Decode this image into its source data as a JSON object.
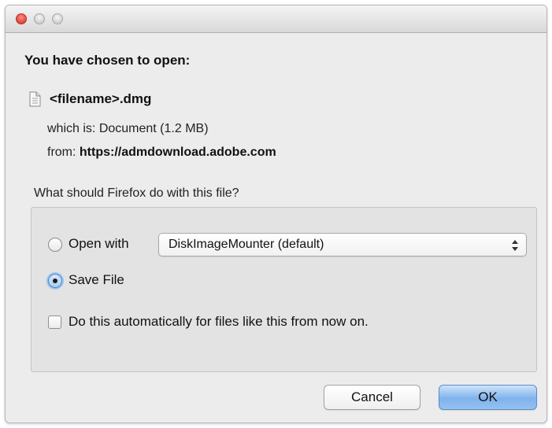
{
  "window": {
    "heading": "You have chosen to open:"
  },
  "file": {
    "name": "<filename>.dmg",
    "icon": "document-icon",
    "which_is_label": "which is:",
    "which_is_value": "Document (1.2 MB)",
    "from_label": "from:",
    "from_value": "https://admdownload.adobe.com"
  },
  "question": "What should Firefox do with this file?",
  "options": {
    "open_with": {
      "label": "Open with",
      "selected": false,
      "app_value": "DiskImageMounter (default)"
    },
    "save_file": {
      "label": "Save File",
      "selected": true
    },
    "auto": {
      "label": "Do this automatically for files like this from now on.",
      "checked": false
    }
  },
  "buttons": {
    "cancel": "Cancel",
    "ok": "OK"
  },
  "colors": {
    "close_button": "#e0443b",
    "default_button": "#7fb2ec",
    "window_bg": "#ececec"
  }
}
